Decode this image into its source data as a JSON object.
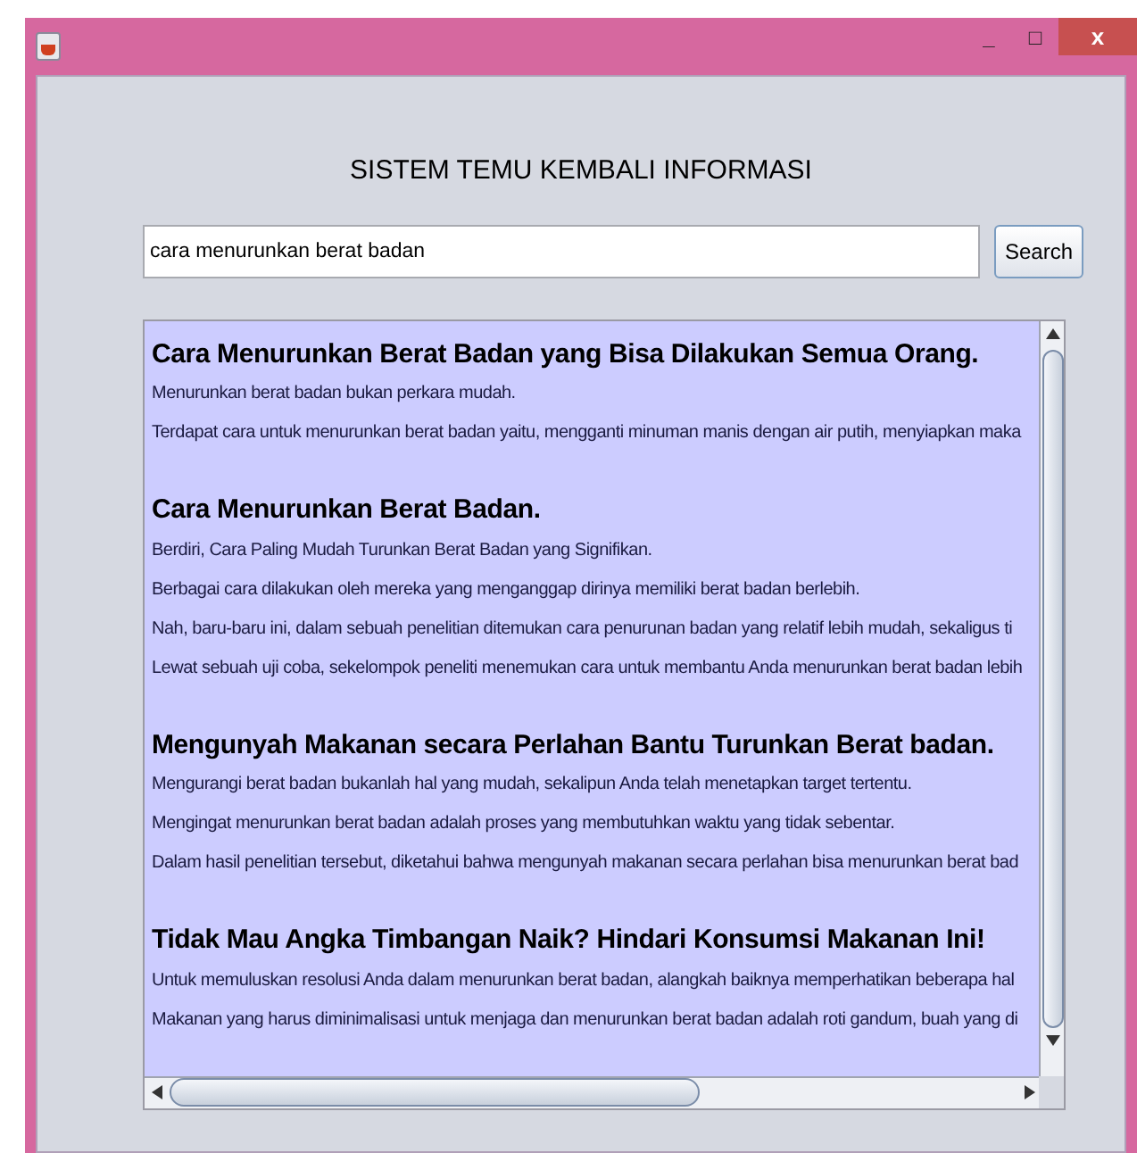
{
  "window": {
    "title_buttons": [
      "_",
      "□",
      "x"
    ]
  },
  "title": "SISTEM TEMU KEMBALI INFORMASI",
  "search": {
    "value": "cara menurunkan berat badan",
    "button": "Search"
  },
  "results": [
    {
      "heading": "Cara Menurunkan Berat Badan yang Bisa Dilakukan Semua Orang.",
      "lines": [
        "Menurunkan berat badan bukan perkara mudah.",
        "Terdapat cara untuk menurunkan berat badan yaitu, mengganti minuman manis dengan air putih, menyiapkan maka"
      ]
    },
    {
      "heading": "Cara Menurunkan Berat Badan.",
      "lines": [
        "Berdiri, Cara Paling Mudah Turunkan Berat Badan yang Signifikan.",
        "Berbagai cara dilakukan oleh mereka yang menganggap dirinya memiliki berat badan berlebih.",
        "Nah, baru-baru ini, dalam sebuah penelitian ditemukan cara penurunan badan yang relatif lebih mudah, sekaligus ti",
        "Lewat sebuah uji coba, sekelompok peneliti menemukan cara untuk membantu Anda menurunkan berat badan lebih"
      ]
    },
    {
      "heading": "Mengunyah Makanan secara Perlahan Bantu Turunkan Berat badan.",
      "lines": [
        "Mengurangi berat badan bukanlah hal yang mudah, sekalipun Anda telah menetapkan target tertentu.",
        "Mengingat menurunkan berat badan adalah proses yang membutuhkan waktu yang tidak sebentar.",
        "Dalam hasil penelitian tersebut, diketahui bahwa mengunyah makanan secara perlahan bisa menurunkan berat bad"
      ]
    },
    {
      "heading": "Tidak Mau Angka Timbangan Naik? Hindari Konsumsi Makanan Ini!",
      "lines": [
        "Untuk memuluskan resolusi Anda dalam menurunkan berat badan, alangkah baiknya memperhatikan beberapa hal",
        "Makanan yang harus diminimalisasi untuk menjaga dan menurunkan berat badan adalah roti gandum, buah yang di"
      ]
    }
  ]
}
